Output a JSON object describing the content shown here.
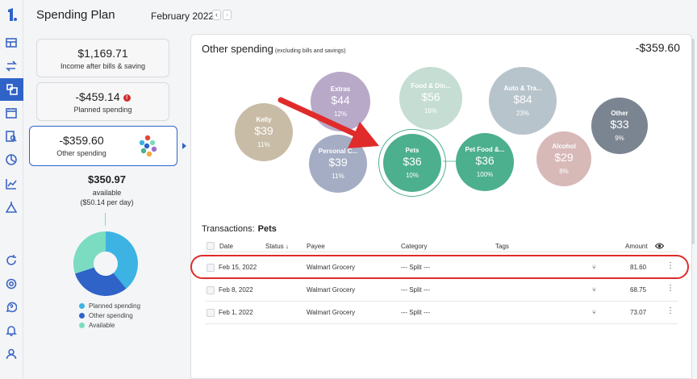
{
  "header": {
    "title": "Spending Plan",
    "month": "February 2022",
    "prev": "‹",
    "next": "›"
  },
  "rail_icons": [
    "logo-icon",
    "budget-grid-icon",
    "transfer-icon",
    "spending-plan-icon",
    "calendar-icon",
    "report-search-icon",
    "pie-chart-icon",
    "trend-chart-icon",
    "goal-icon",
    "refresh-icon",
    "settings-icon",
    "help-icon",
    "notification-icon",
    "account-icon"
  ],
  "summary": {
    "income": {
      "amount": "$1,169.71",
      "label": "Income after bills & saving"
    },
    "planned": {
      "amount": "-$459.14",
      "label": "Planned spending",
      "warning": "!"
    },
    "other": {
      "amount": "-$359.60",
      "label": "Other spending"
    },
    "available": {
      "amount": "$350.97",
      "label": "available",
      "per_day": "($50.14 per day)"
    }
  },
  "donut": {
    "segments": [
      {
        "name": "Planned spending",
        "value": 0.39,
        "color": "#3db3e3"
      },
      {
        "name": "Other spending",
        "value": 0.31,
        "color": "#2f63c8"
      },
      {
        "name": "Available",
        "value": 0.3,
        "color": "#7bdcc1"
      }
    ]
  },
  "legend": [
    "Planned spending",
    "Other spending",
    "Available"
  ],
  "panel": {
    "title": "Other spending",
    "subtitle": "(excluding bills and savings)",
    "total": "-$359.60"
  },
  "bubbles": [
    {
      "name": "Kelly",
      "amount": "$39",
      "pct": "11%",
      "color": "#c8bca7"
    },
    {
      "name": "Extras",
      "amount": "$44",
      "pct": "12%",
      "color": "#b8a9c9"
    },
    {
      "name": "Personal C...",
      "amount": "$39",
      "pct": "11%",
      "color": "#a4adc4"
    },
    {
      "name": "Food & Din...",
      "amount": "$56",
      "pct": "16%",
      "color": "#c5ddd2"
    },
    {
      "name": "Pets",
      "amount": "$36",
      "pct": "10%",
      "color": "#4caf8e"
    },
    {
      "name": "Pet Food &...",
      "amount": "$36",
      "pct": "100%",
      "color": "#4caf8e"
    },
    {
      "name": "Auto & Tra...",
      "amount": "$84",
      "pct": "23%",
      "color": "#b7c4cb"
    },
    {
      "name": "Alcohol",
      "amount": "$29",
      "pct": "8%",
      "color": "#d7b9b8"
    },
    {
      "name": "Other",
      "amount": "$33",
      "pct": "9%",
      "color": "#7b8591"
    }
  ],
  "transactions": {
    "title": "Transactions:",
    "filter": "Pets",
    "columns": {
      "date": "Date",
      "status": "Status",
      "payee": "Payee",
      "category": "Category",
      "tags": "Tags",
      "amount": "Amount"
    },
    "rows": [
      {
        "date": "Feb 15, 2022",
        "payee": "Walmart Grocery",
        "category": "--- Split ---",
        "amount": "81.60"
      },
      {
        "date": "Feb 8, 2022",
        "payee": "Walmart Grocery",
        "category": "--- Split ---",
        "amount": "68.75"
      },
      {
        "date": "Feb 1, 2022",
        "payee": "Walmart Grocery",
        "category": "--- Split ---",
        "amount": "73.07"
      }
    ]
  },
  "colors": {
    "accent": "#2f63c8",
    "highlight": "#e02b2b",
    "selected_bubble": "#4caf8e"
  }
}
